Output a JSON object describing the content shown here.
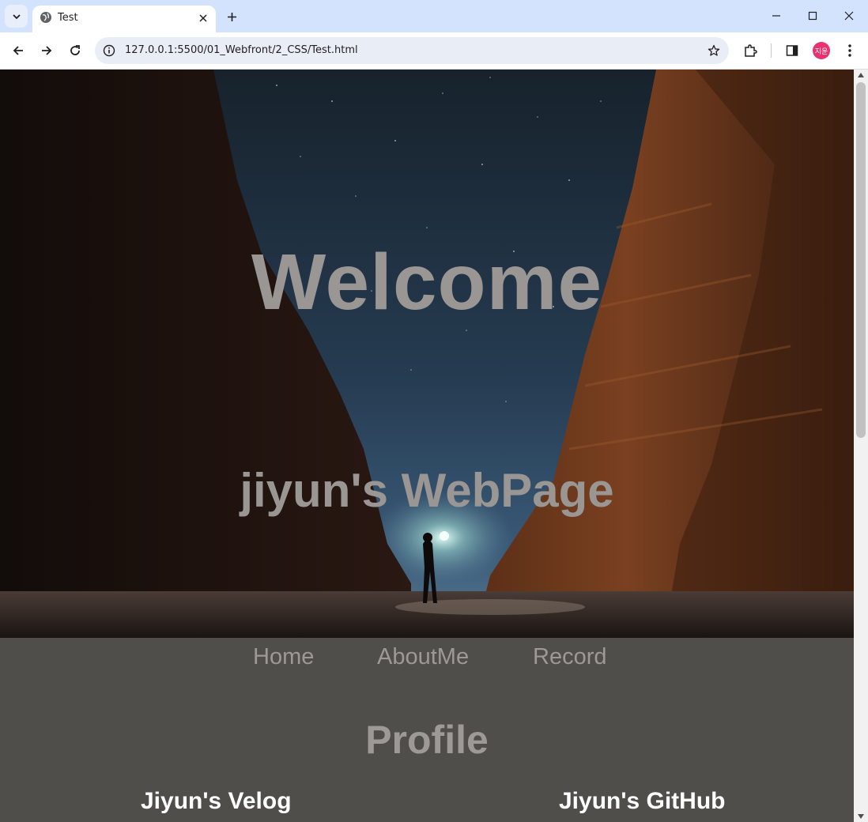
{
  "browser": {
    "tab_title": "Test",
    "url": "127.0.0.1:5500/01_Webfront/2_CSS/Test.html",
    "profile_initials": "지윤",
    "icons": {
      "tab_search": "chevron-down-icon",
      "favicon": "globe-icon",
      "tab_close": "close-icon",
      "new_tab": "plus-icon",
      "minimize": "minimize-icon",
      "maximize": "maximize-icon",
      "close_window": "close-icon",
      "back": "back-arrow-icon",
      "forward": "forward-arrow-icon",
      "reload": "reload-icon",
      "site_info": "info-icon",
      "bookmark": "star-icon",
      "extensions": "puzzle-icon",
      "side_panel": "side-panel-icon",
      "menu": "kebab-menu-icon"
    },
    "colors": {
      "tabbar": "#d3e3fd",
      "omnibox": "#e9eef6",
      "avatar": "#e8336e"
    }
  },
  "hero": {
    "title": "Welcome",
    "subtitle": "jiyun's WebPage"
  },
  "nav": {
    "items": [
      {
        "label": "Home"
      },
      {
        "label": "AboutMe"
      },
      {
        "label": "Record"
      }
    ]
  },
  "profile": {
    "heading": "Profile",
    "links": [
      {
        "label": "Jiyun's Velog"
      },
      {
        "label": "Jiyun's GitHub"
      }
    ]
  },
  "colors": {
    "page_background": "#4f4e4b",
    "heading_text": "#9c9996",
    "link_text": "#ffffff"
  }
}
